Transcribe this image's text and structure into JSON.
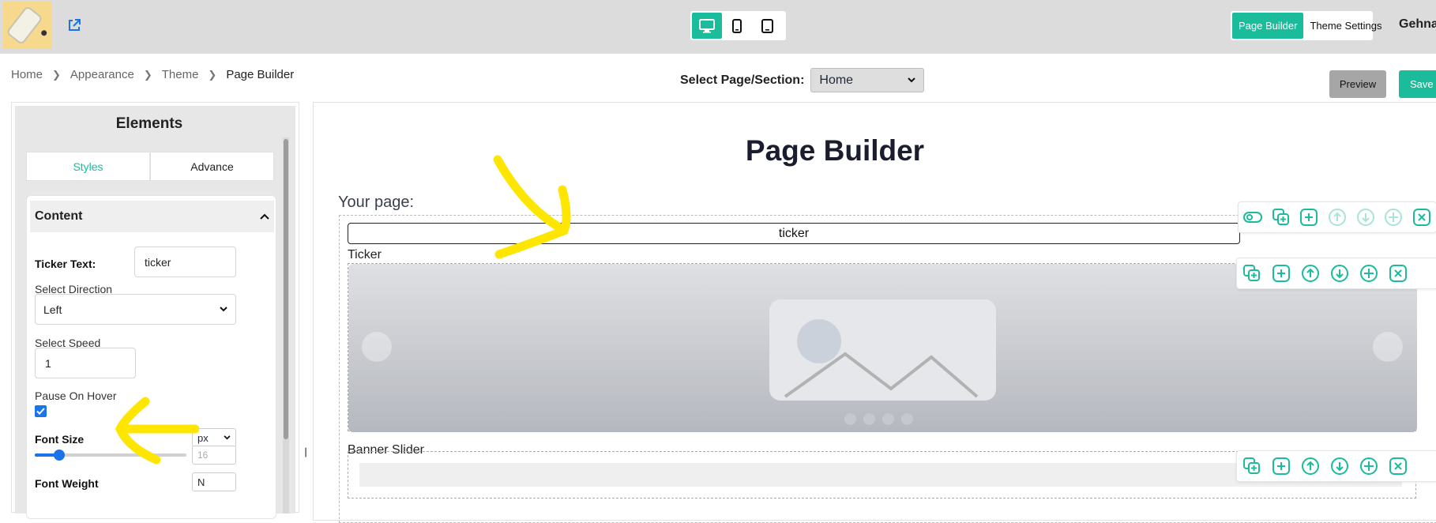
{
  "colors": {
    "accent": "#1abc9c",
    "topbar": "#dcdcdc",
    "checkbox": "#1a73e8",
    "annotation": "#ffe600"
  },
  "header": {
    "logo_icon": "phone-product-logo",
    "external_link_icon": "external-link-icon",
    "device_modes": [
      {
        "icon": "desktop-icon",
        "active": true
      },
      {
        "icon": "mobile-icon",
        "active": false
      },
      {
        "icon": "tablet-icon",
        "active": false
      }
    ],
    "mode_buttons": [
      "Page Builder",
      "Theme Settings"
    ],
    "user_name": "Gehna"
  },
  "breadcrumb": [
    "Home",
    "Appearance",
    "Theme",
    "Page Builder"
  ],
  "section_selector": {
    "label": "Select Page/Section:",
    "value": "Home"
  },
  "actions": {
    "preview": "Preview",
    "save": "Save p"
  },
  "elements_panel": {
    "title": "Elements",
    "tabs": [
      "Styles",
      "Advance"
    ],
    "active_tab": "Styles",
    "content": {
      "heading": "Content",
      "ticker_text_label": "Ticker Text:",
      "ticker_text_value": "ticker",
      "direction_label": "Select Direction",
      "direction_value": "Left",
      "speed_label": "Select Speed",
      "speed_value": "1",
      "pause_label": "Pause On Hover",
      "pause_checked": true,
      "font_size_label": "Font Size",
      "font_size_unit": "px",
      "font_size_value": "16",
      "next_label": "Font Weight",
      "next_select": "N"
    }
  },
  "canvas": {
    "title": "Page Builder",
    "your_page": "Your page:",
    "ticker_text": "ticker",
    "blocks": [
      "Ticker",
      "Banner Slider"
    ],
    "toolbar_icons": [
      "eye-icon",
      "copy-icon",
      "add-icon",
      "move-up-icon",
      "move-down-icon",
      "drag-icon",
      "close-icon"
    ]
  }
}
